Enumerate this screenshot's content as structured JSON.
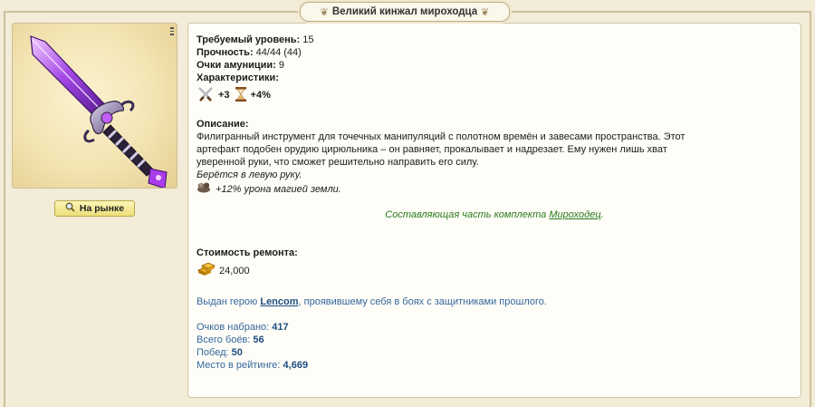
{
  "item": {
    "title": "Великий кинжал мироходца",
    "market_button": "На рынке"
  },
  "props": {
    "level_label": "Требуемый уровень:",
    "level_value": "15",
    "durability_label": "Прочность:",
    "durability_value": "44/44  (44)",
    "ammo_label": "Очки амуниции:",
    "ammo_value": "9",
    "characteristics_label": "Характеристики:",
    "stats": [
      {
        "icon": "crossed-swords-icon",
        "value": "+3"
      },
      {
        "icon": "hourglass-icon",
        "value": "+4%"
      }
    ]
  },
  "description": {
    "label": "Описание:",
    "text_lines": [
      "Филигранный инструмент для точечных манипуляций с полотном времён и завесами пространства. Этот",
      "артефакт подобен орудию цирюльника – он равняет, прокалывает и надрезает. Ему нужен лишь хват",
      "уверенной руки, что сможет решительно направить его силу."
    ],
    "hand": "Берётся в левую руку.",
    "effect": "+12% урона магией земли."
  },
  "set": {
    "prefix": "Составляющая часть комплекта ",
    "name": "Мироходец",
    "suffix": "."
  },
  "repair": {
    "label": "Стоимость ремонта:",
    "value": "24,000"
  },
  "owner": {
    "prefix": "Выдан герою ",
    "hero": "Lencom",
    "suffix": ", проявившему себя в боях с защитниками прошлого."
  },
  "scores": {
    "points_label": "Очков набрано: ",
    "points_value": "417",
    "battles_label": "Всего боёв: ",
    "battles_value": "56",
    "wins_label": "Побед: ",
    "wins_value": "50",
    "rank_label": "Место в рейтинге: ",
    "rank_value": "4,669"
  },
  "colors": {
    "background": "#f3ecd8",
    "set_green": "#2a7a1a",
    "info_blue": "#35679e",
    "dagger_purple": "#8a2fd0"
  }
}
